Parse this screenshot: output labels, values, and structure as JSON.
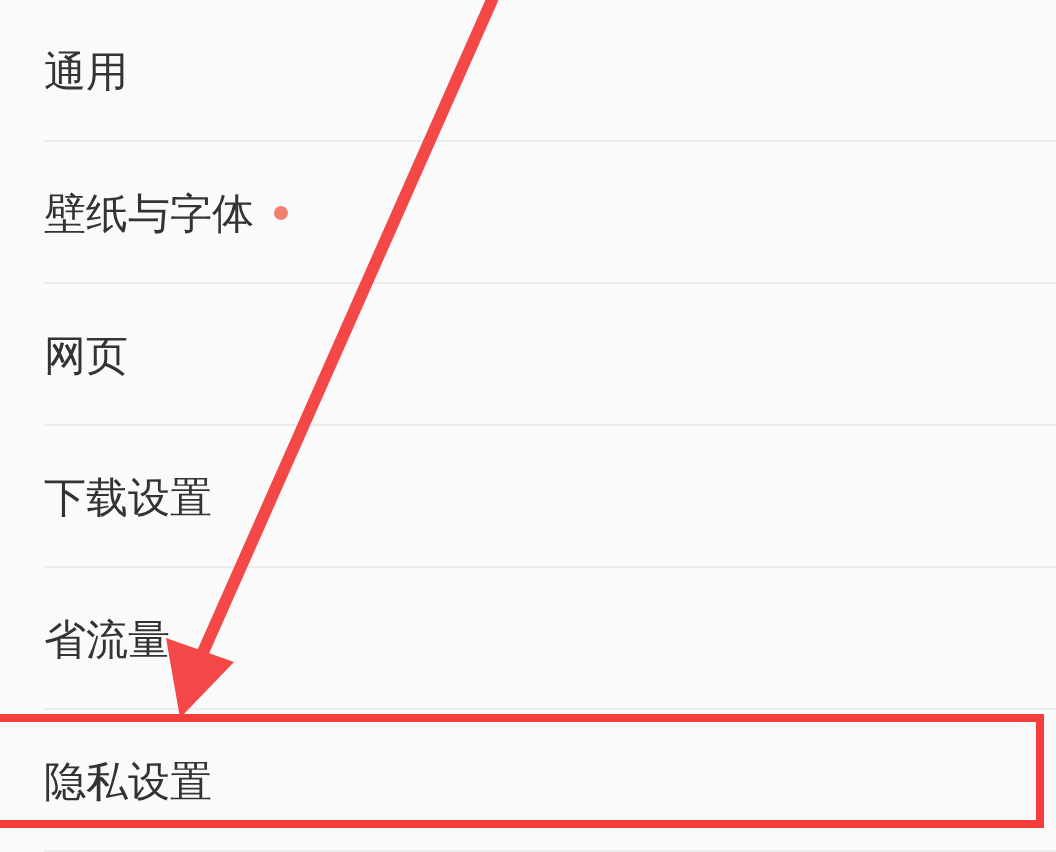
{
  "settings_list": [
    {
      "label": "通用",
      "dot": false,
      "highlighted": false
    },
    {
      "label": "壁纸与字体",
      "dot": true,
      "highlighted": false
    },
    {
      "label": "网页",
      "dot": false,
      "highlighted": false
    },
    {
      "label": "下载设置",
      "dot": false,
      "highlighted": false
    },
    {
      "label": "省流量",
      "dot": false,
      "highlighted": false
    },
    {
      "label": "隐私设置",
      "dot": false,
      "highlighted": true
    }
  ]
}
